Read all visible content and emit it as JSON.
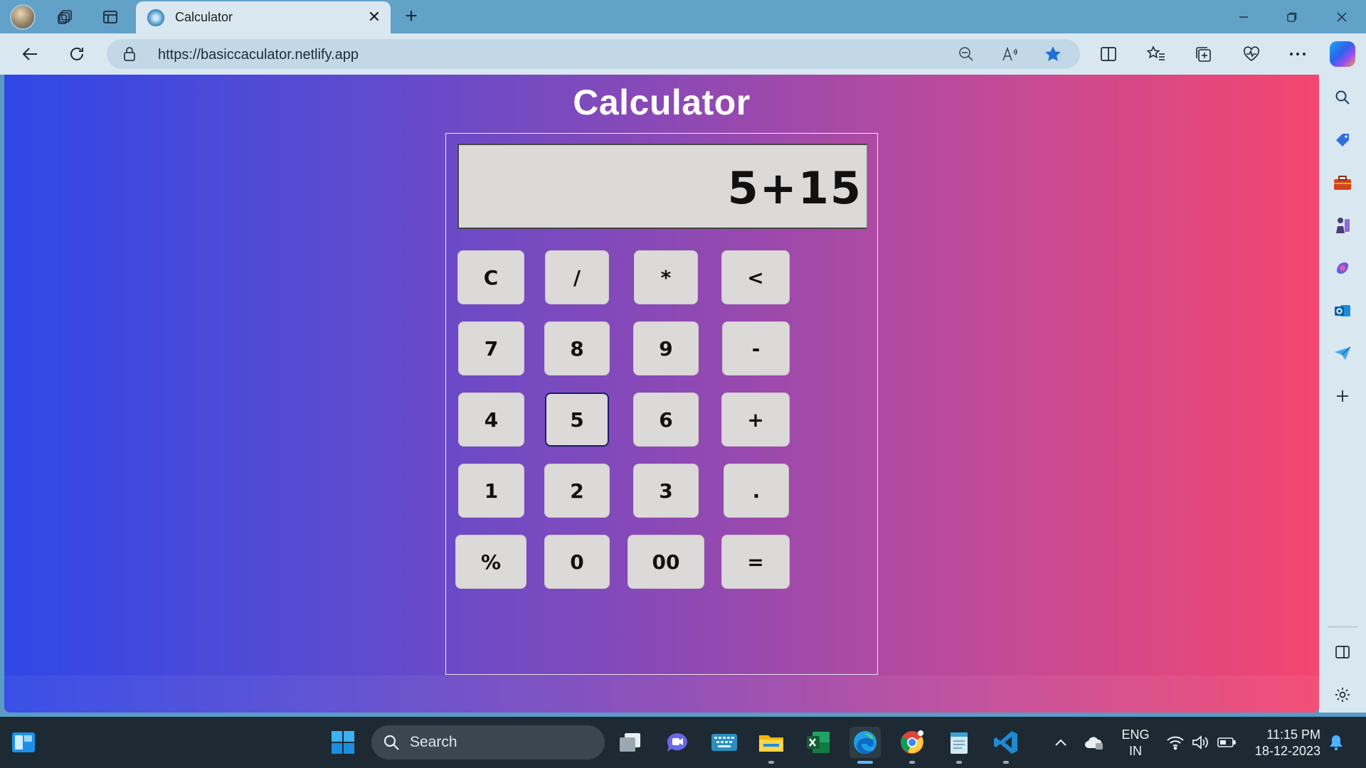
{
  "browser": {
    "tab_title": "Calculator",
    "url": "https://basiccaculator.netlify.app",
    "new_tab_symbol": "+",
    "close_symbol": "✕"
  },
  "page": {
    "title": "Calculator",
    "display": "5+15",
    "keys": [
      [
        "C",
        "/",
        "*",
        "<"
      ],
      [
        "7",
        "8",
        "9",
        "-"
      ],
      [
        "4",
        "5",
        "6",
        "+"
      ],
      [
        "1",
        "2",
        "3",
        "."
      ],
      [
        "%",
        "0",
        "00",
        "="
      ]
    ],
    "focused_key": "5"
  },
  "taskbar": {
    "search_placeholder": "Search",
    "language_line1": "ENG",
    "language_line2": "IN",
    "time": "11:15 PM",
    "date": "18-12-2023"
  },
  "colors": {
    "gradient_left": "#3047e6",
    "gradient_right": "#f4466f",
    "key_background": "#dcd9d9"
  }
}
